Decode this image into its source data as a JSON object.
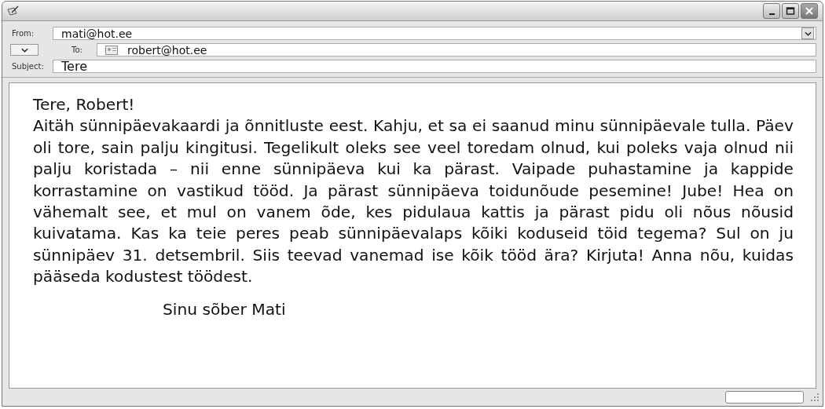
{
  "header": {
    "from": {
      "label": "From:",
      "value": "mati@hot.ee"
    },
    "to": {
      "label": "To:",
      "value": "robert@hot.ee"
    },
    "subject": {
      "label": "Subject:",
      "value": "Tere"
    }
  },
  "body": {
    "greeting": "Tere, Robert!",
    "paragraph": "Aitäh sünnipäevakaardi ja õnnitluste eest. Kahju, et sa ei saanud minu sünnipäevale tulla. Päev oli tore, sain palju kingitusi. Tegelikult oleks see veel toredam olnud, kui poleks vaja olnud nii palju koristada – nii enne sünnipäeva kui ka pärast. Vaipade puhastamine ja kappide korrastamine on vastikud tööd. Ja pärast sünnipäeva toidunõude pesemine! Jube! Hea on vähemalt see, et mul on vanem õde, kes pidulaua kattis ja pärast pidu oli nõus nõusid kuivatama. Kas ka teie peres peab sünnipäevalaps kõiki koduseid töid tegema? Sul on ju sünnipäev 31. detsembril. Siis teevad vanemad ise kõik tööd ära? Kirjuta! Anna nõu, kuidas pääseda kodustest töödest.",
    "signature": "Sinu sõber Mati"
  }
}
